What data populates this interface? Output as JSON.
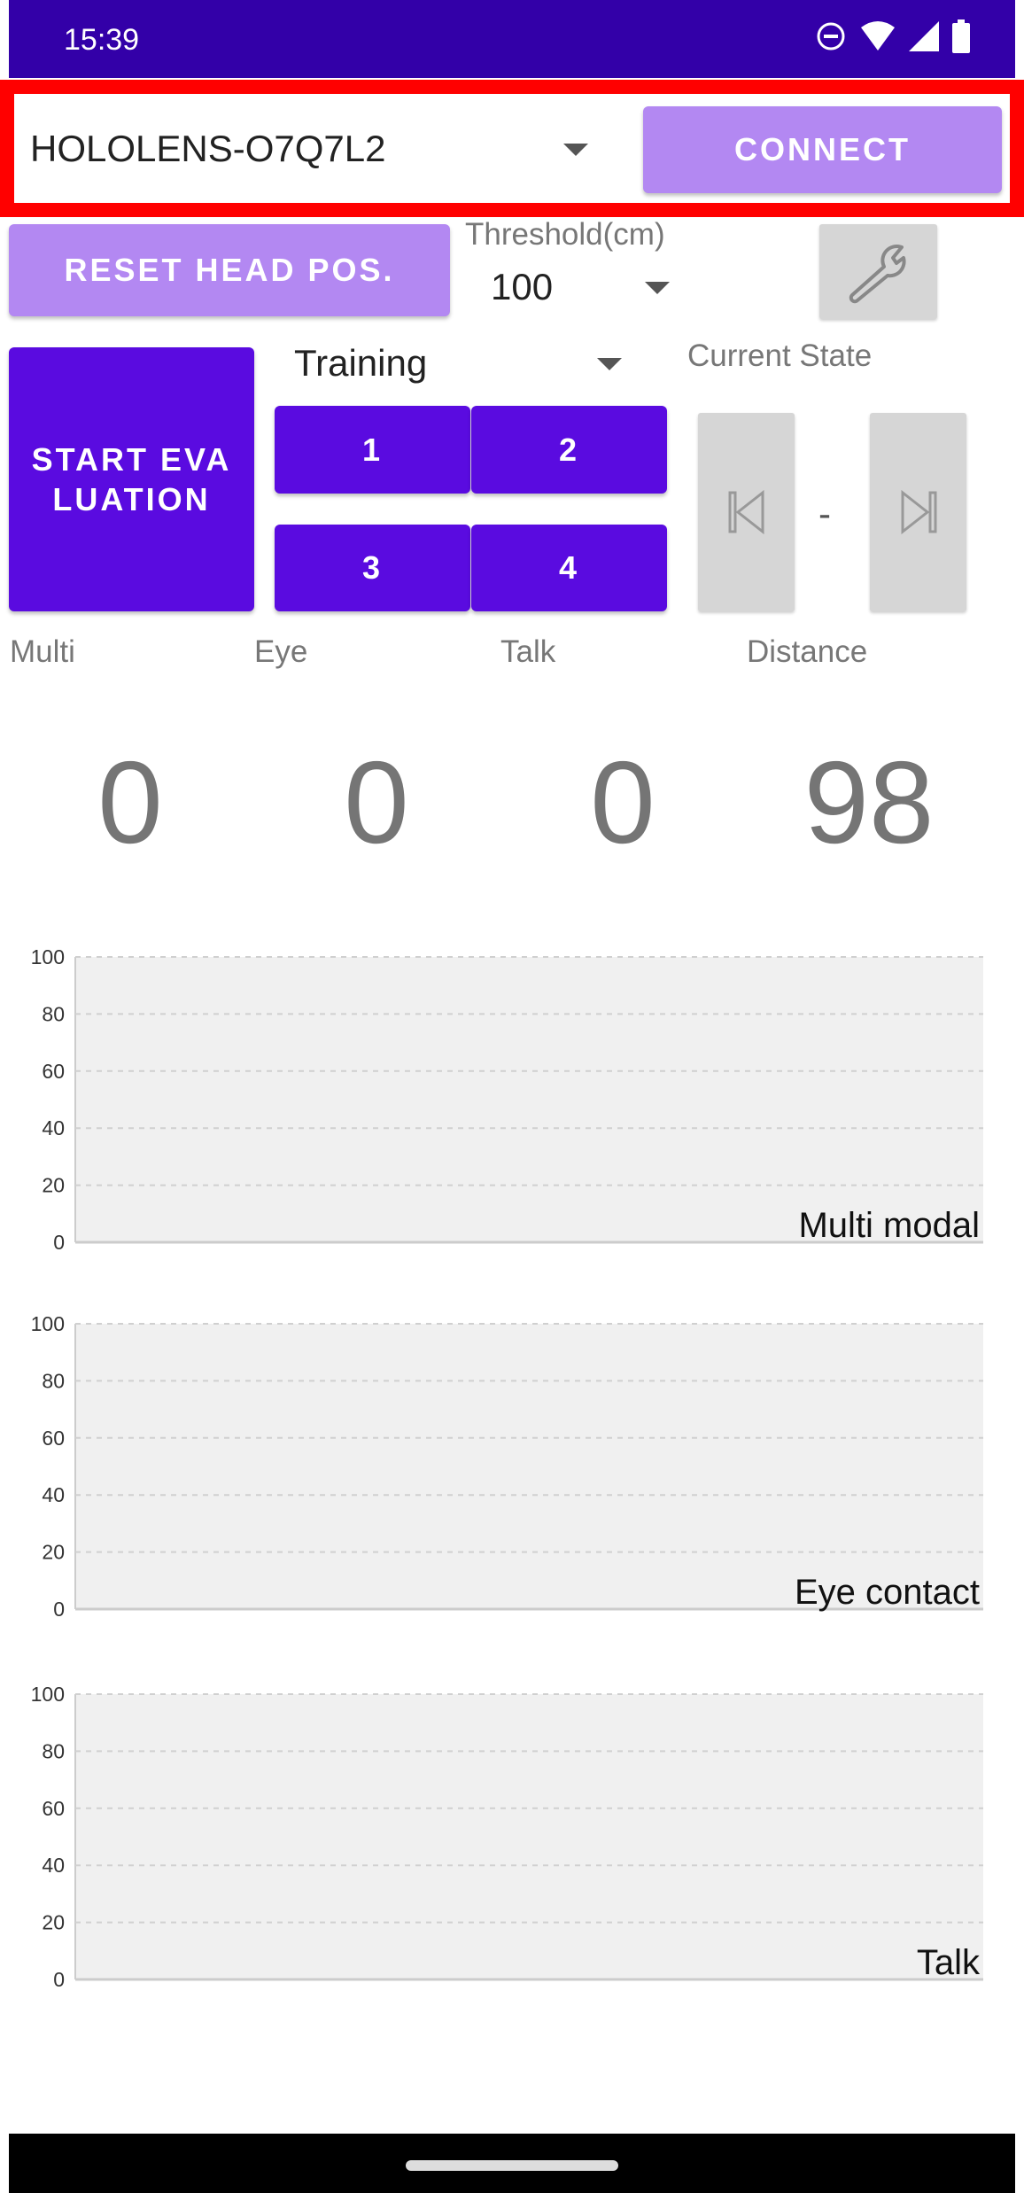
{
  "status_bar": {
    "time": "15:39",
    "icons": [
      "do-not-disturb-icon",
      "wifi-icon",
      "signal-icon",
      "battery-icon"
    ]
  },
  "device_spinner": {
    "value": "HOLOLENS-O7Q7L2"
  },
  "connect_button": "CONNECT",
  "reset_button": "RESET HEAD POS.",
  "threshold": {
    "label": "Threshold(cm)",
    "value": "100"
  },
  "settings_icon": "wrench-icon",
  "start_button": "START EVALUATION",
  "mode_spinner": {
    "value": "Training"
  },
  "stage_buttons": [
    "1",
    "2",
    "3",
    "4"
  ],
  "current_state": {
    "label": "Current State",
    "value": "-"
  },
  "metrics": [
    {
      "label": "Multi",
      "value": "0"
    },
    {
      "label": "Eye",
      "value": "0"
    },
    {
      "label": "Talk",
      "value": "0"
    },
    {
      "label": "Distance",
      "value": "98"
    }
  ],
  "colors": {
    "status_bar": "#3300a8",
    "primary": "#5a0be0",
    "primary_light": "#b388f2",
    "highlight": "#ff0000",
    "chart_bg": "#f0f0f0"
  },
  "chart_data": [
    {
      "type": "line",
      "title": "Multi modal",
      "ylim": [
        0,
        100
      ],
      "yticks": [
        "0",
        "20",
        "40",
        "60",
        "80",
        "100"
      ],
      "grid": true,
      "series": []
    },
    {
      "type": "line",
      "title": "Eye contact",
      "ylim": [
        0,
        100
      ],
      "yticks": [
        "0",
        "20",
        "40",
        "60",
        "80",
        "100"
      ],
      "grid": true,
      "series": []
    },
    {
      "type": "line",
      "title": "Talk",
      "ylim": [
        0,
        100
      ],
      "yticks": [
        "0",
        "20",
        "40",
        "60",
        "80",
        "100"
      ],
      "grid": true,
      "series": []
    }
  ]
}
